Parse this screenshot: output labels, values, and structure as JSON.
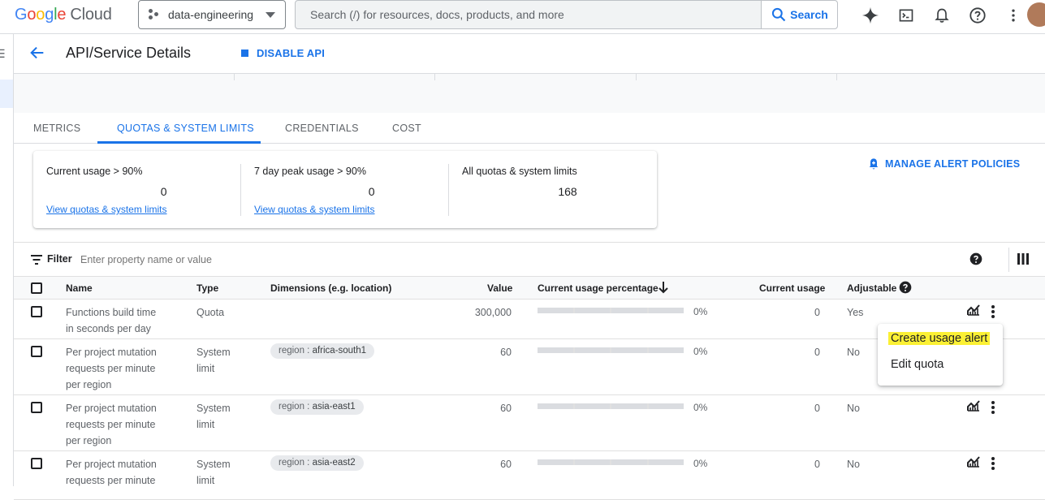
{
  "topbar": {
    "logo_google": "Google",
    "logo_cloud": "Cloud",
    "project_name": "data-engineering",
    "search_placeholder": "Search (/) for resources, docs, products, and more",
    "search_button": "Search"
  },
  "header": {
    "title": "API/Service Details",
    "disable_api": "DISABLE API"
  },
  "tabs": [
    "METRICS",
    "QUOTAS & SYSTEM LIMITS",
    "CREDENTIALS",
    "COST"
  ],
  "summary": {
    "stats": [
      {
        "label": "Current usage > 90%",
        "value": "0",
        "link": "View quotas & system limits"
      },
      {
        "label": "7 day peak usage > 90%",
        "value": "0",
        "link": "View quotas & system limits"
      },
      {
        "label": "All quotas & system limits",
        "value": "168"
      }
    ],
    "manage_alerts": "MANAGE ALERT POLICIES"
  },
  "filter": {
    "label": "Filter",
    "placeholder": "Enter property name or value"
  },
  "table": {
    "headers": {
      "name": "Name",
      "type": "Type",
      "dimensions": "Dimensions (e.g. location)",
      "value": "Value",
      "usage_pct": "Current usage percentage",
      "current_usage": "Current usage",
      "adjustable": "Adjustable"
    },
    "rows": [
      {
        "name_l1": "Functions build time",
        "name_l2": "in seconds per day",
        "name_l3": "",
        "type_l1": "Quota",
        "type_l2": "",
        "dim_key": "",
        "dim_val": "",
        "value": "300,000",
        "pct": "0%",
        "usage_fraction": 0,
        "current": "0",
        "adjustable": "Yes"
      },
      {
        "name_l1": "Per project mutation",
        "name_l2": "requests per minute",
        "name_l3": "per region",
        "type_l1": "System",
        "type_l2": "limit",
        "dim_key": "region : ",
        "dim_val": "africa-south1",
        "value": "60",
        "pct": "0%",
        "usage_fraction": 0,
        "current": "0",
        "adjustable": "No"
      },
      {
        "name_l1": "Per project mutation",
        "name_l2": "requests per minute",
        "name_l3": "per region",
        "type_l1": "System",
        "type_l2": "limit",
        "dim_key": "region : ",
        "dim_val": "asia-east1",
        "value": "60",
        "pct": "0%",
        "usage_fraction": 0,
        "current": "0",
        "adjustable": "No"
      },
      {
        "name_l1": "Per project mutation",
        "name_l2": "requests per minute",
        "name_l3": "",
        "type_l1": "System",
        "type_l2": "limit",
        "dim_key": "region : ",
        "dim_val": "asia-east2",
        "value": "60",
        "pct": "0%",
        "usage_fraction": 0,
        "current": "0",
        "adjustable": "No"
      }
    ]
  },
  "context_menu": {
    "items": [
      "Create usage alert",
      "Edit quota"
    ]
  },
  "colors": {
    "accent": "#1a73e8",
    "highlight": "#fbf034"
  }
}
